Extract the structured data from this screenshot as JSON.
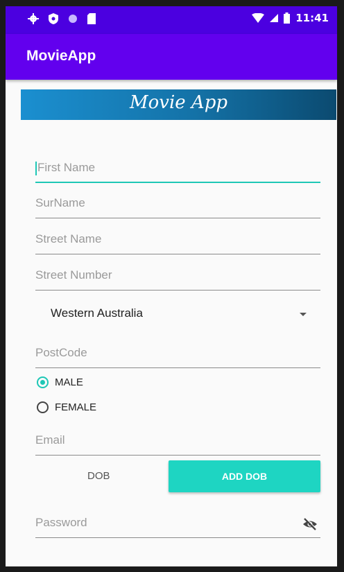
{
  "status_bar": {
    "time": "11:41"
  },
  "app_bar": {
    "title": "MovieApp"
  },
  "banner": {
    "text": "Movie App"
  },
  "form": {
    "first_name_hint": "First Name",
    "surname_hint": "SurName",
    "street_name_hint": "Street Name",
    "street_number_hint": "Street Number",
    "state_selected": "Western Australia",
    "postcode_hint": "PostCode",
    "gender_options": [
      "MALE",
      "FEMALE"
    ],
    "gender_selected": "MALE",
    "email_hint": "Email",
    "dob_label": "DOB",
    "add_dob_label": "ADD DOB",
    "password_hint": "Password"
  },
  "colors": {
    "status_bar": "#4b00e0",
    "app_bar": "#6200ee",
    "accent": "#1ec7b6",
    "button": "#1ed5c2"
  },
  "icons": [
    "settings-icon",
    "shield-icon",
    "circle-icon",
    "sd-card-icon",
    "wifi-icon",
    "signal-icon",
    "battery-icon",
    "chevron-down-icon",
    "eye-off-icon"
  ]
}
